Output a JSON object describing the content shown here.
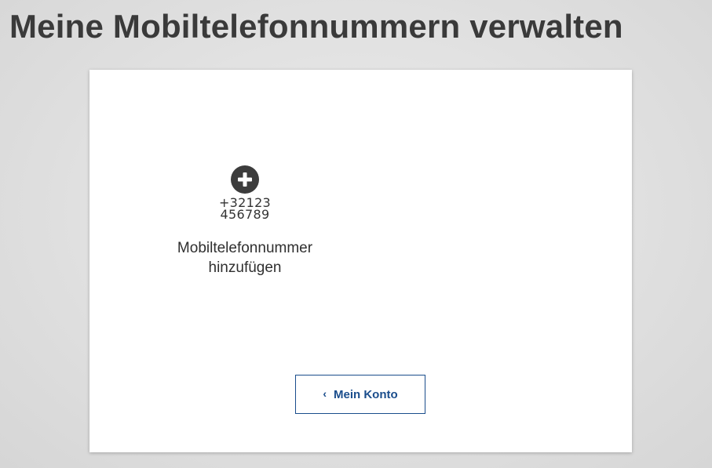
{
  "page": {
    "title": "Meine Mobiltelefonnummern verwalten"
  },
  "add_number": {
    "icon": "plus-circle-icon",
    "sample_number_line1": "+32123",
    "sample_number_line2": "456789",
    "label_line1": "Mobiltelefonnummer",
    "label_line2": "hinzufügen"
  },
  "back_button": {
    "icon": "chevron-left-icon",
    "icon_glyph": "‹",
    "label": "Mein Konto"
  },
  "colors": {
    "title_text": "#3a3a3a",
    "icon_fill": "#3c3c3c",
    "button_accent": "#1a4d8c",
    "card_background": "#ffffff"
  }
}
